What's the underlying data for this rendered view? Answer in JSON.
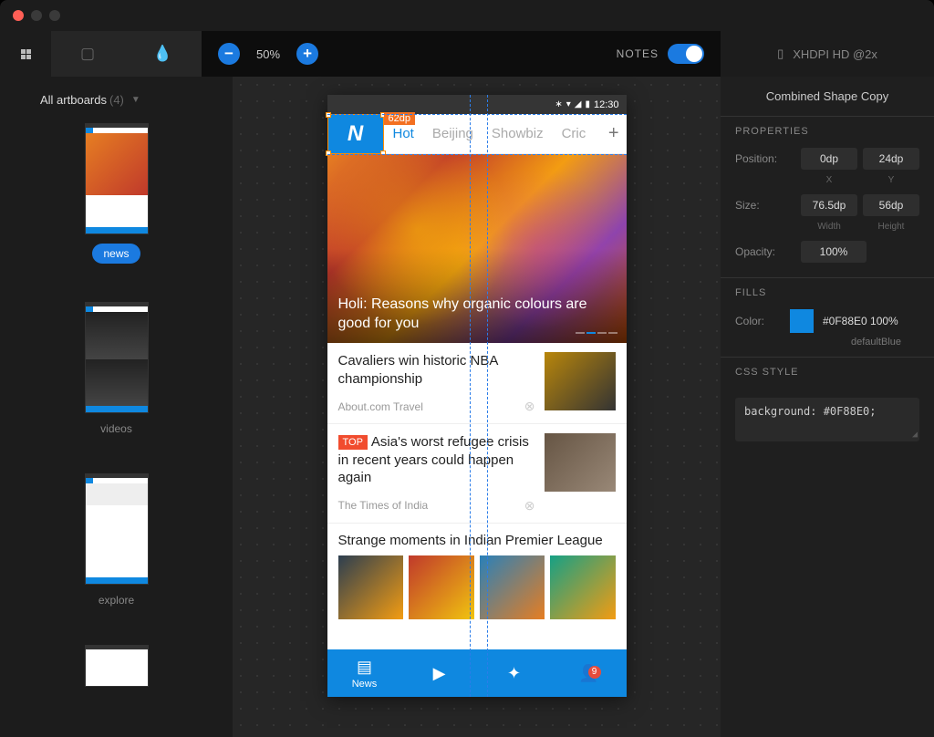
{
  "toolbar": {
    "zoom": "50%",
    "notes_label": "NOTES",
    "device": "XHDPI HD @2x"
  },
  "sidebar": {
    "head": "All artboards",
    "count": "(4)",
    "items": [
      {
        "label": "news"
      },
      {
        "label": "videos"
      },
      {
        "label": "explore"
      }
    ]
  },
  "canvas": {
    "dp_label": "62dp",
    "statusbar_time": "12:30",
    "logo_letter": "N",
    "tabs": [
      "Hot",
      "Beijing",
      "Showbiz",
      "Cric"
    ],
    "hero_title": "Holi: Reasons why organic colours are good for you",
    "item1_title": "Cavaliers win historic NBA championship",
    "item1_source": "About.com Travel",
    "item2_tag": "TOP",
    "item2_title": "Asia's worst refugee crisis in recent years could happen again",
    "item2_source": "The Times of India",
    "section_title": "Strange moments in Indian Premier League",
    "bottomnav": {
      "news": "News",
      "badge": "9"
    }
  },
  "panel": {
    "title": "Combined Shape Copy",
    "properties_head": "PROPERTIES",
    "position_label": "Position:",
    "pos_x": "0dp",
    "pos_x_sub": "X",
    "pos_y": "24dp",
    "pos_y_sub": "Y",
    "size_label": "Size:",
    "width": "76.5dp",
    "width_sub": "Width",
    "height": "56dp",
    "height_sub": "Height",
    "opacity_label": "Opacity:",
    "opacity": "100%",
    "fills_head": "FILLS",
    "color_label": "Color:",
    "color_value": "#0F88E0 100%",
    "color_name": "defaultBlue",
    "css_head": "CSS STYLE",
    "css_value": "background: #0F88E0;"
  }
}
